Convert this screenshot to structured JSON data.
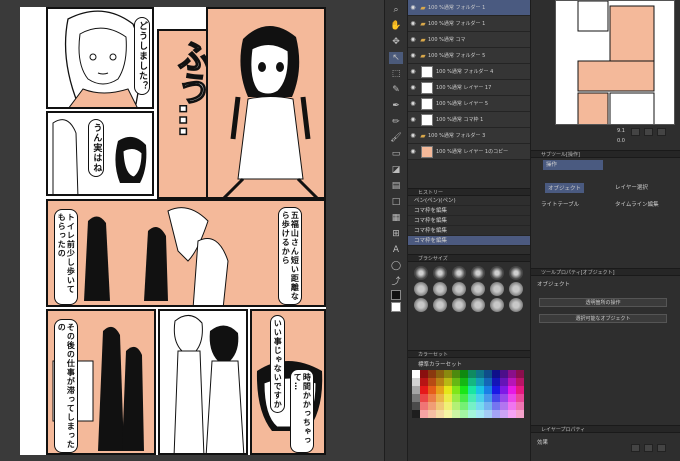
{
  "manga": {
    "speech": [
      "どうしました？",
      "うん実はね",
      "五福山さん短い距離なら歩けるから",
      "トイレ前少し歩いてもらったの",
      "いい事じゃないですか",
      "その後の仕事が滞ってしまったの",
      "時間かかっちゃって…"
    ],
    "sfx": "ふう…"
  },
  "layers": {
    "items": [
      {
        "name": "100 %通常\nフォルダー 1",
        "type": "folder",
        "selected": true
      },
      {
        "name": "100 %通常\nフォルダー 1",
        "type": "folder",
        "selected": false
      },
      {
        "name": "100 %通常\nコマ",
        "type": "folder",
        "selected": false
      },
      {
        "name": "100 %通常\nフォルダー 5",
        "type": "folder",
        "selected": false
      },
      {
        "name": "100 %通常\nフォルダー 4",
        "type": "layer",
        "selected": false
      },
      {
        "name": "100 %通常\nレイヤー 17",
        "type": "layer",
        "selected": false
      },
      {
        "name": "100 %通常\nレイヤー 5",
        "type": "layer",
        "selected": false
      },
      {
        "name": "100 %通常\nコマ枠 1",
        "type": "layer",
        "selected": false
      },
      {
        "name": "100 %通常\nフォルダー 3",
        "type": "folder",
        "selected": false
      },
      {
        "name": "100 %通常\nレイヤー 1のコピー",
        "type": "layer",
        "selected": false
      }
    ]
  },
  "history": {
    "header": "ヒストリー",
    "items": [
      "ペン(ペン)(ペン)",
      "コマ枠を編集",
      "コマ枠を編集",
      "コマ枠を編集",
      "コマ枠を編集"
    ]
  },
  "brush_panel": {
    "header": "ブラシサイズ"
  },
  "color_set": {
    "header": "カラーセット",
    "set_name": "標準カラーセット"
  },
  "subtool": {
    "header": "サブツール[操作]",
    "tab": "操作",
    "items": [
      "オブジェクト",
      "レイヤー選択",
      "ライトテーブル",
      "タイムライン編集"
    ]
  },
  "tool_property": {
    "header": "ツールプロパティ[オブジェクト]",
    "title": "オブジェクト",
    "dropdown1": "透明箇所の操作",
    "dropdown2": "選択可能なオブジェクト"
  },
  "layer_property": {
    "header": "レイヤープロパティ",
    "effect_label": "効果"
  },
  "navigator": {
    "zoom": "9.1",
    "angle": "0.0"
  }
}
